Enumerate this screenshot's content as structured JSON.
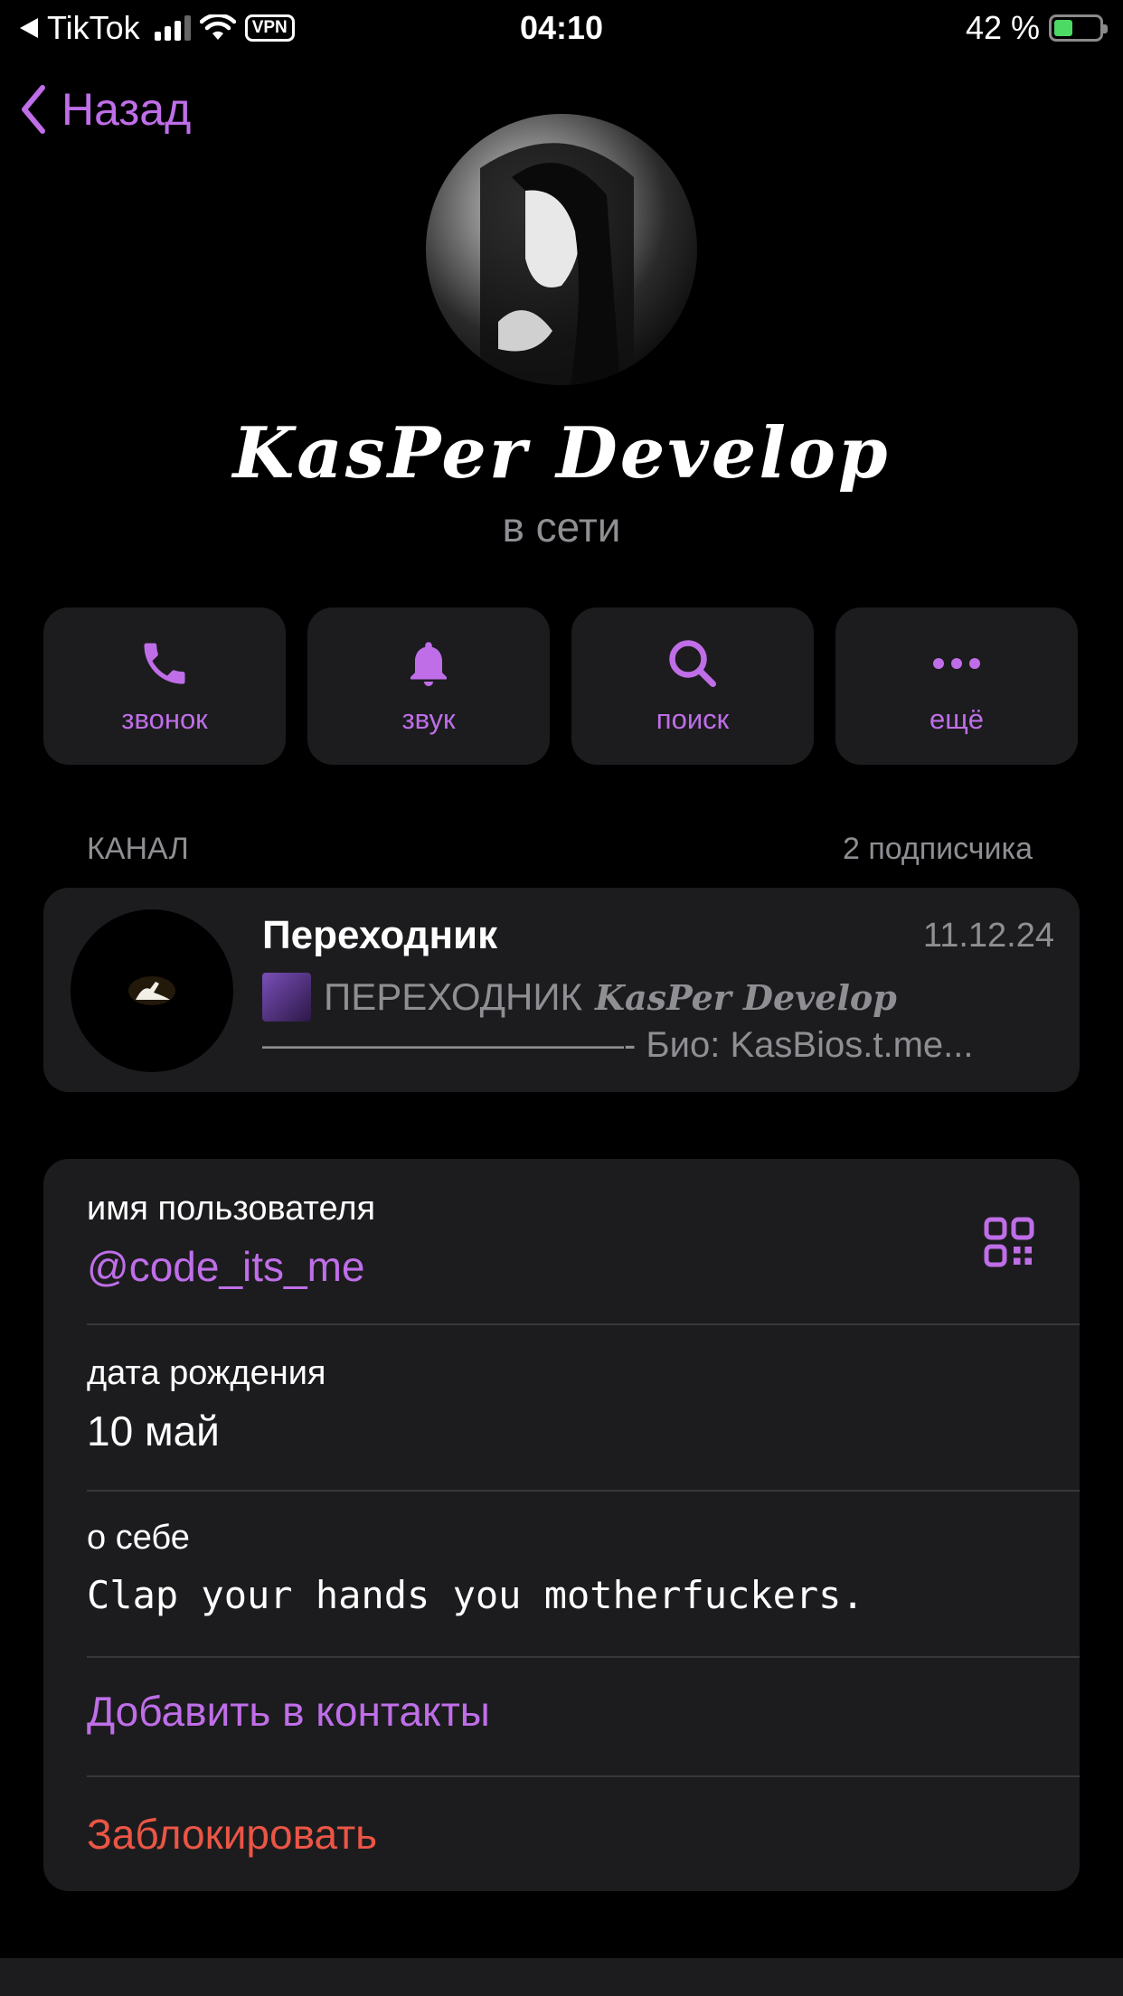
{
  "status_bar": {
    "back_app": "TikTok",
    "vpn": "VPN",
    "time": "04:10",
    "battery_percent": "42 %",
    "battery_level": 0.42
  },
  "nav": {
    "back_label": "Назад"
  },
  "profile": {
    "name": "KasPer Develop",
    "status": "в сети"
  },
  "actions": [
    {
      "label": "звонок",
      "icon": "phone-icon"
    },
    {
      "label": "звук",
      "icon": "bell-icon"
    },
    {
      "label": "поиск",
      "icon": "search-icon"
    },
    {
      "label": "ещё",
      "icon": "more-icon"
    }
  ],
  "channel_section": {
    "header": "КАНАЛ",
    "subscribers": "2 подписчика"
  },
  "channel": {
    "title": "Переходник",
    "date": "11.12.24",
    "preview_prefix": "ПЕРЕХОДНИК",
    "preview_fancy": "KasPer Develop",
    "preview_line2": "——————————- Био: KasBios.t.me..."
  },
  "info": {
    "username_label": "имя пользователя",
    "username_value": "@code_its_me",
    "birthday_label": "дата рождения",
    "birthday_value": "10 май",
    "about_label": "о себе",
    "about_value": "Clap your hands you motherfuckers.",
    "add_contact": "Добавить в контакты",
    "block": "Заблокировать"
  },
  "colors": {
    "accent": "#bf6ee8",
    "danger": "#eb5545",
    "card": "#1c1c1e"
  }
}
